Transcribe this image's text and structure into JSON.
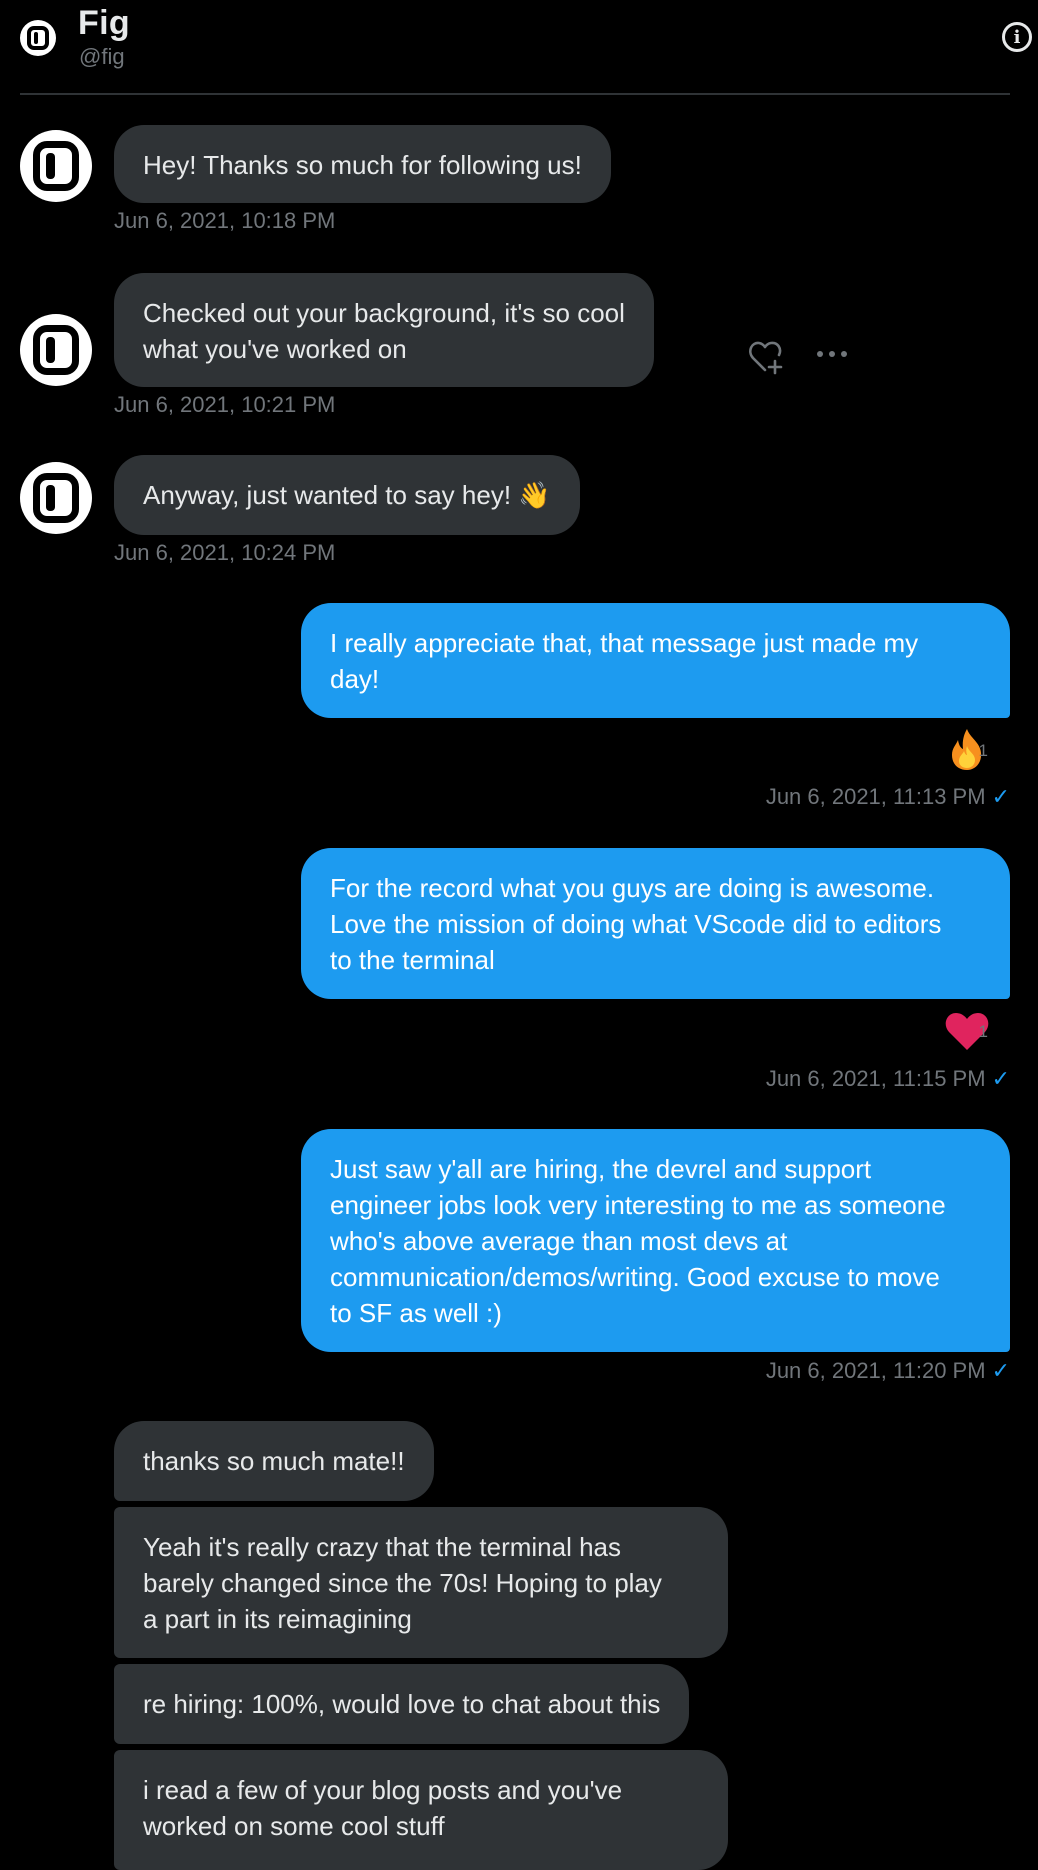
{
  "header": {
    "title": "Fig",
    "handle": "@fig"
  },
  "colors": {
    "background": "#000000",
    "incoming_bubble": "#2f3336",
    "outgoing_bubble": "#1d9bf0",
    "timestamp": "#71767b"
  },
  "messages": [
    {
      "text": "Hey! Thanks so much for following us!",
      "time": "Jun 6, 2021, 10:18 PM"
    },
    {
      "text": "Checked out your background, it's so cool\nwhat you've worked on",
      "time": "Jun 6, 2021, 10:21 PM"
    },
    {
      "text": "Anyway, just wanted to say hey! ",
      "emoji": "👋",
      "time": "Jun 6, 2021, 10:24 PM"
    },
    {
      "text": "I really appreciate that, that message just made my\nday!",
      "reaction_count": "1",
      "reaction_icon": "fire",
      "time": "Jun 6, 2021, 11:13 PM"
    },
    {
      "text": "For the record what you guys are doing is awesome.\nLove the mission of doing what VScode did to editors\nto the terminal",
      "reaction_count": "1",
      "reaction_icon": "heart",
      "time": "Jun 6, 2021, 11:15 PM"
    },
    {
      "text": "Just saw y'all are hiring, the devrel and support\nengineer jobs look very interesting to me as someone\nwho's above average than most devs at\ncommunication/demos/writing. Good excuse to move\nto SF as well :)",
      "time": "Jun 6, 2021, 11:20 PM"
    },
    {
      "text": "thanks so much mate!!"
    },
    {
      "text": "Yeah it's really crazy that the terminal has\nbarely changed since the 70s! Hoping to play\na part in its reimagining"
    },
    {
      "text": "re hiring: 100%, would love to chat about this"
    },
    {
      "text": "i read a few of your blog posts and you've\nworked on some cool stuff"
    }
  ],
  "seen_mark": "✓"
}
